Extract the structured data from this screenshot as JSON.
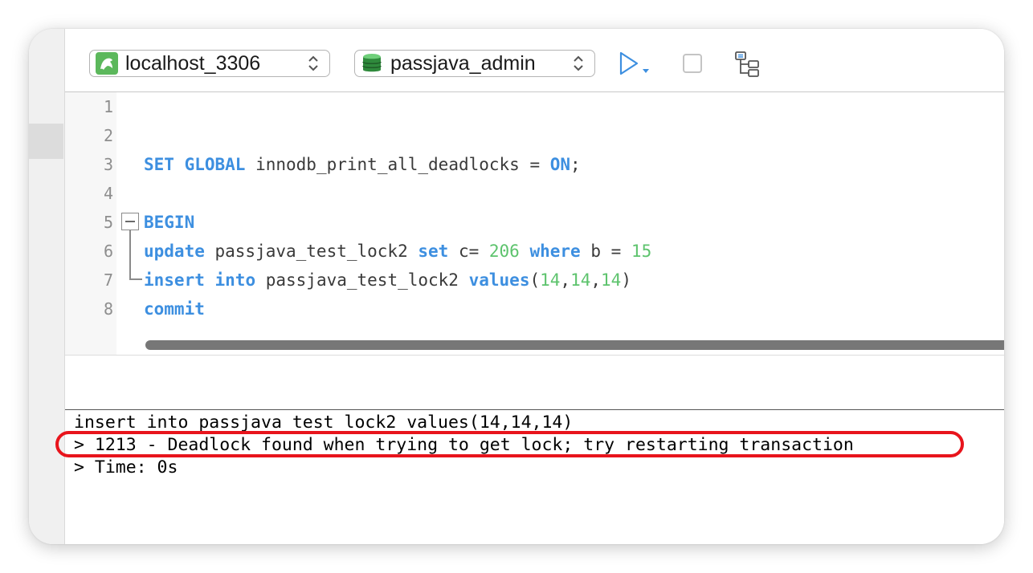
{
  "toolbar": {
    "connection": {
      "label": "localhost_3306",
      "icon": "mysql-dolphin-icon",
      "icon_color": "#5cb85c"
    },
    "database": {
      "label": "passjava_admin",
      "icon": "database-cylinder-icon",
      "icon_color": "#3a9a4a"
    },
    "run_icon": "play-icon",
    "stop_icon": "stop-icon",
    "explain_icon": "explain-tree-icon",
    "accent_color": "#3d8fe0"
  },
  "editor": {
    "line_numbers": [
      "1",
      "2",
      "3",
      "4",
      "5",
      "6",
      "7",
      "8"
    ],
    "lines": [
      {
        "tokens": []
      },
      {
        "tokens": []
      },
      {
        "tokens": [
          {
            "t": "SET",
            "k": "kw"
          },
          {
            "t": " "
          },
          {
            "t": "GLOBAL",
            "k": "kw"
          },
          {
            "t": " innodb_print_all_deadlocks = "
          },
          {
            "t": "ON",
            "k": "kw"
          },
          {
            "t": ";"
          }
        ]
      },
      {
        "tokens": []
      },
      {
        "tokens": [
          {
            "t": "BEGIN",
            "k": "kw"
          }
        ]
      },
      {
        "tokens": [
          {
            "t": "update",
            "k": "kw"
          },
          {
            "t": " passjava_test_lock2 "
          },
          {
            "t": "set",
            "k": "kw"
          },
          {
            "t": " c= "
          },
          {
            "t": "206",
            "k": "num"
          },
          {
            "t": " "
          },
          {
            "t": "where",
            "k": "kw"
          },
          {
            "t": " b = "
          },
          {
            "t": "15",
            "k": "num"
          }
        ]
      },
      {
        "tokens": [
          {
            "t": "insert",
            "k": "kw"
          },
          {
            "t": " "
          },
          {
            "t": "into",
            "k": "kw"
          },
          {
            "t": " passjava_test_lock2 "
          },
          {
            "t": "values",
            "k": "kw"
          },
          {
            "t": "("
          },
          {
            "t": "14",
            "k": "num"
          },
          {
            "t": ","
          },
          {
            "t": "14",
            "k": "num"
          },
          {
            "t": ","
          },
          {
            "t": "14",
            "k": "num"
          },
          {
            "t": ")"
          }
        ]
      },
      {
        "tokens": [
          {
            "t": "commit",
            "k": "kw"
          }
        ]
      }
    ]
  },
  "messages": {
    "query": "insert into passjava_test_lock2 values(14,14,14)",
    "error": "> 1213 - Deadlock found when trying to get lock; try restarting transaction",
    "time": "> Time: 0s",
    "highlight_color": "#e8141c"
  }
}
